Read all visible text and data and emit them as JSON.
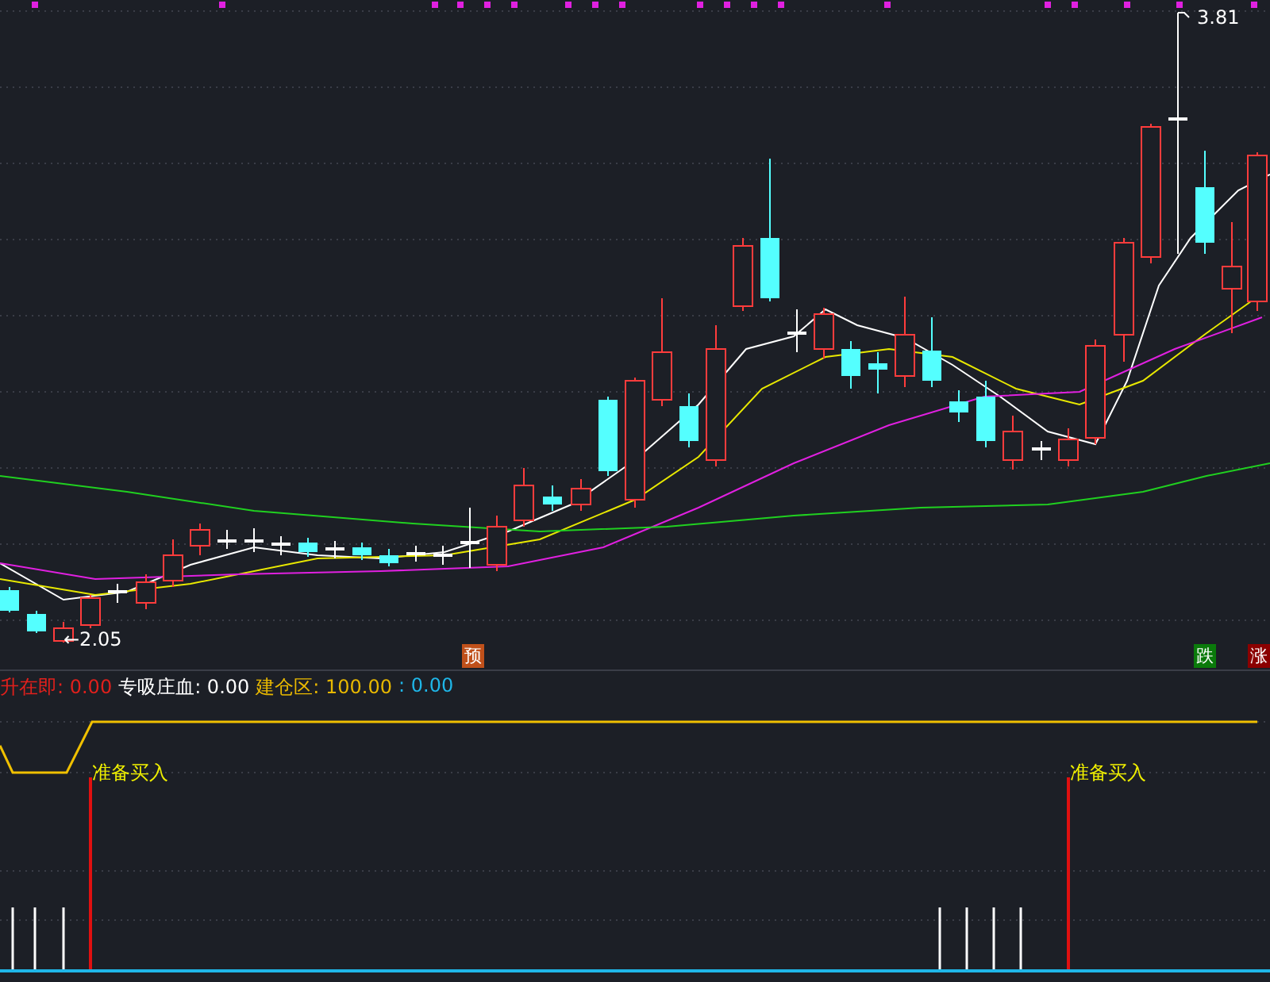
{
  "price_chart": {
    "high_label": "3.81",
    "low_label": "←2.05",
    "markers": [
      {
        "text": "预",
        "color": "#c0501a"
      },
      {
        "text": "跌",
        "color": "#0a7a0a"
      },
      {
        "text": "涨",
        "color": "#8b0000"
      }
    ]
  },
  "indicator": {
    "legend": [
      {
        "text": "升在即: 0.00",
        "color": "#e0201c"
      },
      {
        "text": "专吸庄血: 0.00",
        "color": "#ffffff"
      },
      {
        "text": "建仓区: 100.00",
        "color": "#e8b800"
      },
      {
        "text": ": 0.00",
        "color": "#1fb6e8"
      }
    ],
    "signals": [
      "准备买入",
      "准备买入"
    ]
  }
}
